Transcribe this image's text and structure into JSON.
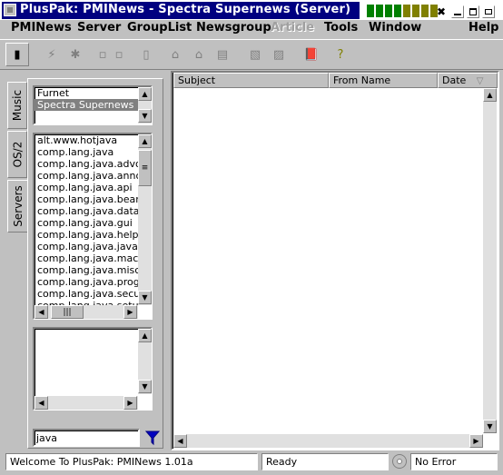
{
  "window": {
    "title": "PlusPak: PMINews  -  Spectra Supernews (Server)",
    "meter_colors": [
      "#008000",
      "#008000",
      "#008000",
      "#008000",
      "#808000",
      "#808000",
      "#808000",
      "#808000"
    ]
  },
  "menubar": {
    "items": [
      {
        "label": "PMINews"
      },
      {
        "label": "Server"
      },
      {
        "label": "GroupList"
      },
      {
        "label": "Newsgroup"
      },
      {
        "label": "Article"
      },
      {
        "label": "Tools"
      },
      {
        "label": "Window"
      },
      {
        "label": "Help"
      }
    ]
  },
  "left_tabs": {
    "items": [
      {
        "label": "Music"
      },
      {
        "label": "OS/2"
      },
      {
        "label": "Servers"
      }
    ]
  },
  "servers": {
    "items": [
      "Furnet",
      "Spectra Supernews"
    ],
    "selected": "Spectra Supernews"
  },
  "groups": {
    "items": [
      "alt.www.hotjava",
      "comp.lang.java",
      "comp.lang.java.advocacy",
      "comp.lang.java.announce",
      "comp.lang.java.api",
      "comp.lang.java.beans",
      "comp.lang.java.databases",
      "comp.lang.java.gui",
      "comp.lang.java.help",
      "comp.lang.java.javascript",
      "comp.lang.java.machine",
      "comp.lang.java.misc",
      "comp.lang.java.programmer",
      "comp.lang.java.security",
      "comp.lang.java.setup"
    ]
  },
  "filter": {
    "value": "java"
  },
  "articles": {
    "columns": {
      "subject": "Subject",
      "from": "From Name",
      "date": "Date"
    }
  },
  "statusbar": {
    "welcome": "Welcome To PlusPak: PMINews 1.01a",
    "state": "Ready",
    "error": "No Error"
  }
}
